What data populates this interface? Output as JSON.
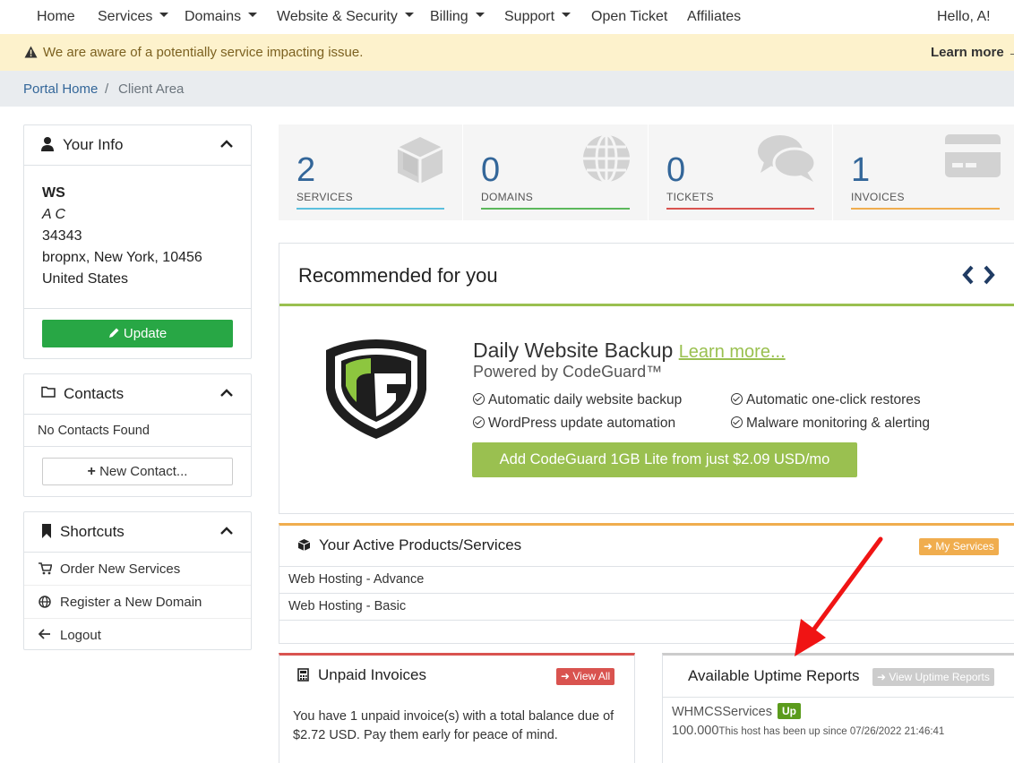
{
  "nav": {
    "home": "Home",
    "services": "Services",
    "domains": "Domains",
    "website_security": "Website & Security",
    "billing": "Billing",
    "support": "Support",
    "open_ticket": "Open Ticket",
    "affiliates": "Affiliates",
    "user": "Hello, A!"
  },
  "alert": {
    "message": "We are aware of a potentially service impacting issue.",
    "learn_more": "Learn more →"
  },
  "breadcrumb": {
    "home": "Portal Home",
    "separator": "/",
    "current": "Client Area"
  },
  "your_info": {
    "title": "Your Info",
    "company": "WS",
    "name": "A C",
    "address1": "34343",
    "city_line": "bropnx, New York, 10456",
    "country": "United States",
    "update_label": "Update"
  },
  "contacts": {
    "title": "Contacts",
    "empty": "No Contacts Found",
    "new_label": "New Contact..."
  },
  "shortcuts": {
    "title": "Shortcuts",
    "items": [
      {
        "label": "Order New Services",
        "icon": "cart-icon"
      },
      {
        "label": "Register a New Domain",
        "icon": "globe-icon"
      },
      {
        "label": "Logout",
        "icon": "arrow-left-icon"
      }
    ]
  },
  "stats": [
    {
      "count": "2",
      "label": "SERVICES",
      "color": "#5bc0de",
      "icon": "cube-icon"
    },
    {
      "count": "0",
      "label": "DOMAINS",
      "color": "#5cb85c",
      "icon": "globe-icon"
    },
    {
      "count": "0",
      "label": "TICKETS",
      "color": "#d9534f",
      "icon": "comments-icon"
    },
    {
      "count": "1",
      "label": "INVOICES",
      "color": "#f0ad4e",
      "icon": "credit-card-icon"
    }
  ],
  "recommended": {
    "title": "Recommended for you",
    "product_title": "Daily Website Backup",
    "learn_more": "Learn more...",
    "powered_by": "Powered by CodeGuard™",
    "features": [
      "Automatic daily website backup",
      "Automatic one-click restores",
      "WordPress update automation",
      "Malware monitoring & alerting"
    ],
    "cta": "Add CodeGuard 1GB Lite from just $2.09 USD/mo",
    "accent": "#9ac050"
  },
  "active_products": {
    "title": "Your Active Products/Services",
    "button": "My Services",
    "items": [
      "Web Hosting - Advance",
      "Web Hosting - Basic"
    ]
  },
  "unpaid_invoices": {
    "title": "Unpaid Invoices",
    "button": "View All",
    "body": "You have 1 unpaid invoice(s) with a total balance due of $2.72 USD. Pay them early for peace of mind."
  },
  "uptime": {
    "title": "Available Uptime Reports",
    "button": "View Uptime Reports",
    "service": "WHMCSServices",
    "status": "Up",
    "percent": "100.000",
    "since": "This host has been up since 07/26/2022 21:46:41"
  }
}
